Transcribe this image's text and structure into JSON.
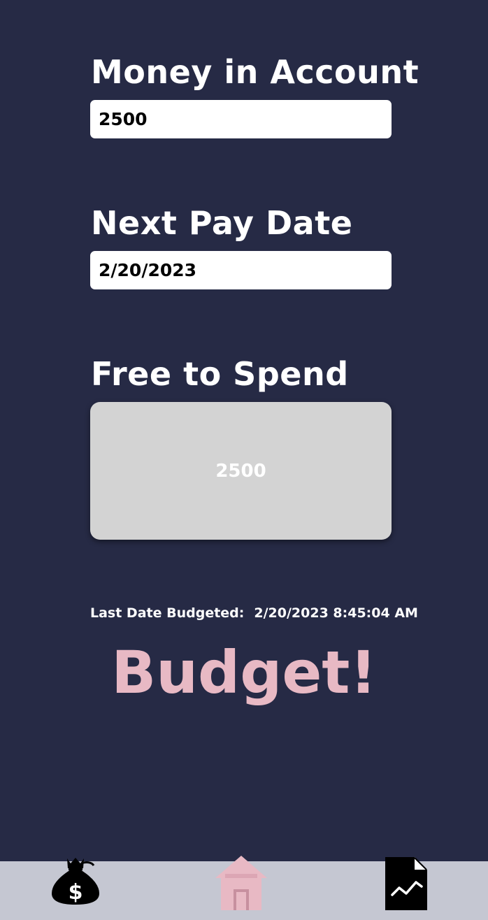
{
  "money": {
    "label": "Money in Account",
    "value": "2500"
  },
  "pay_date": {
    "label": "Next Pay Date",
    "value": "2/20/2023"
  },
  "free": {
    "label": "Free to Spend",
    "value": "2500"
  },
  "last_budgeted": {
    "label": "Last Date Budgeted:",
    "value": "2/20/2023 8:45:04 AM"
  },
  "budget_button": {
    "label": "Budget!"
  },
  "tabbar": {
    "tabs": [
      {
        "icon": "money-bag-icon",
        "active": false
      },
      {
        "icon": "home-icon",
        "active": true
      },
      {
        "icon": "chart-document-icon",
        "active": false
      }
    ]
  },
  "colors": {
    "background": "#262a45",
    "accent": "#e8b9c4",
    "tabbar": "#c5c7d2",
    "panel": "#d3d3d3"
  }
}
